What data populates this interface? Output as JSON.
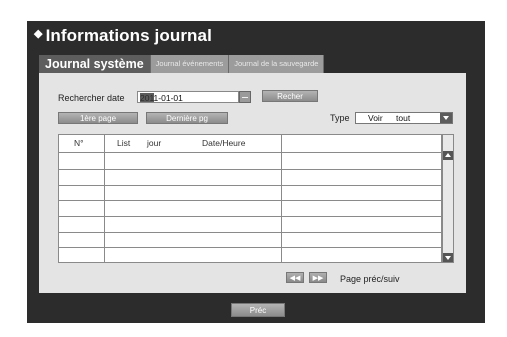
{
  "title": "Informations journal",
  "tabs": [
    {
      "label": "Journal système",
      "active": true
    },
    {
      "label": "Journal événements",
      "active": false
    },
    {
      "label": "Journal de la sauvegarde",
      "active": false
    }
  ],
  "search": {
    "label": "Rechercher date",
    "date_value": "2011-01-01",
    "search_button": "Recher"
  },
  "nav": {
    "first_page": "1ère page",
    "last_page": "Dernière pg"
  },
  "type_filter": {
    "label": "Type",
    "selected": [
      "Voir",
      "tout"
    ]
  },
  "table": {
    "columns": [
      "N°",
      "List",
      "jour",
      "Date/Heure"
    ]
  },
  "pagination": {
    "prev_symbol": "◀◀",
    "next_symbol": "▶▶",
    "label": "Page préc/suiv"
  },
  "footer": {
    "prev_button": "Préc"
  },
  "colors": {
    "frame": "#2c2c2c",
    "panel": "#e4e4e4",
    "tab_active": "#5d5d5d",
    "tab_inactive": "#9c9c9c"
  }
}
